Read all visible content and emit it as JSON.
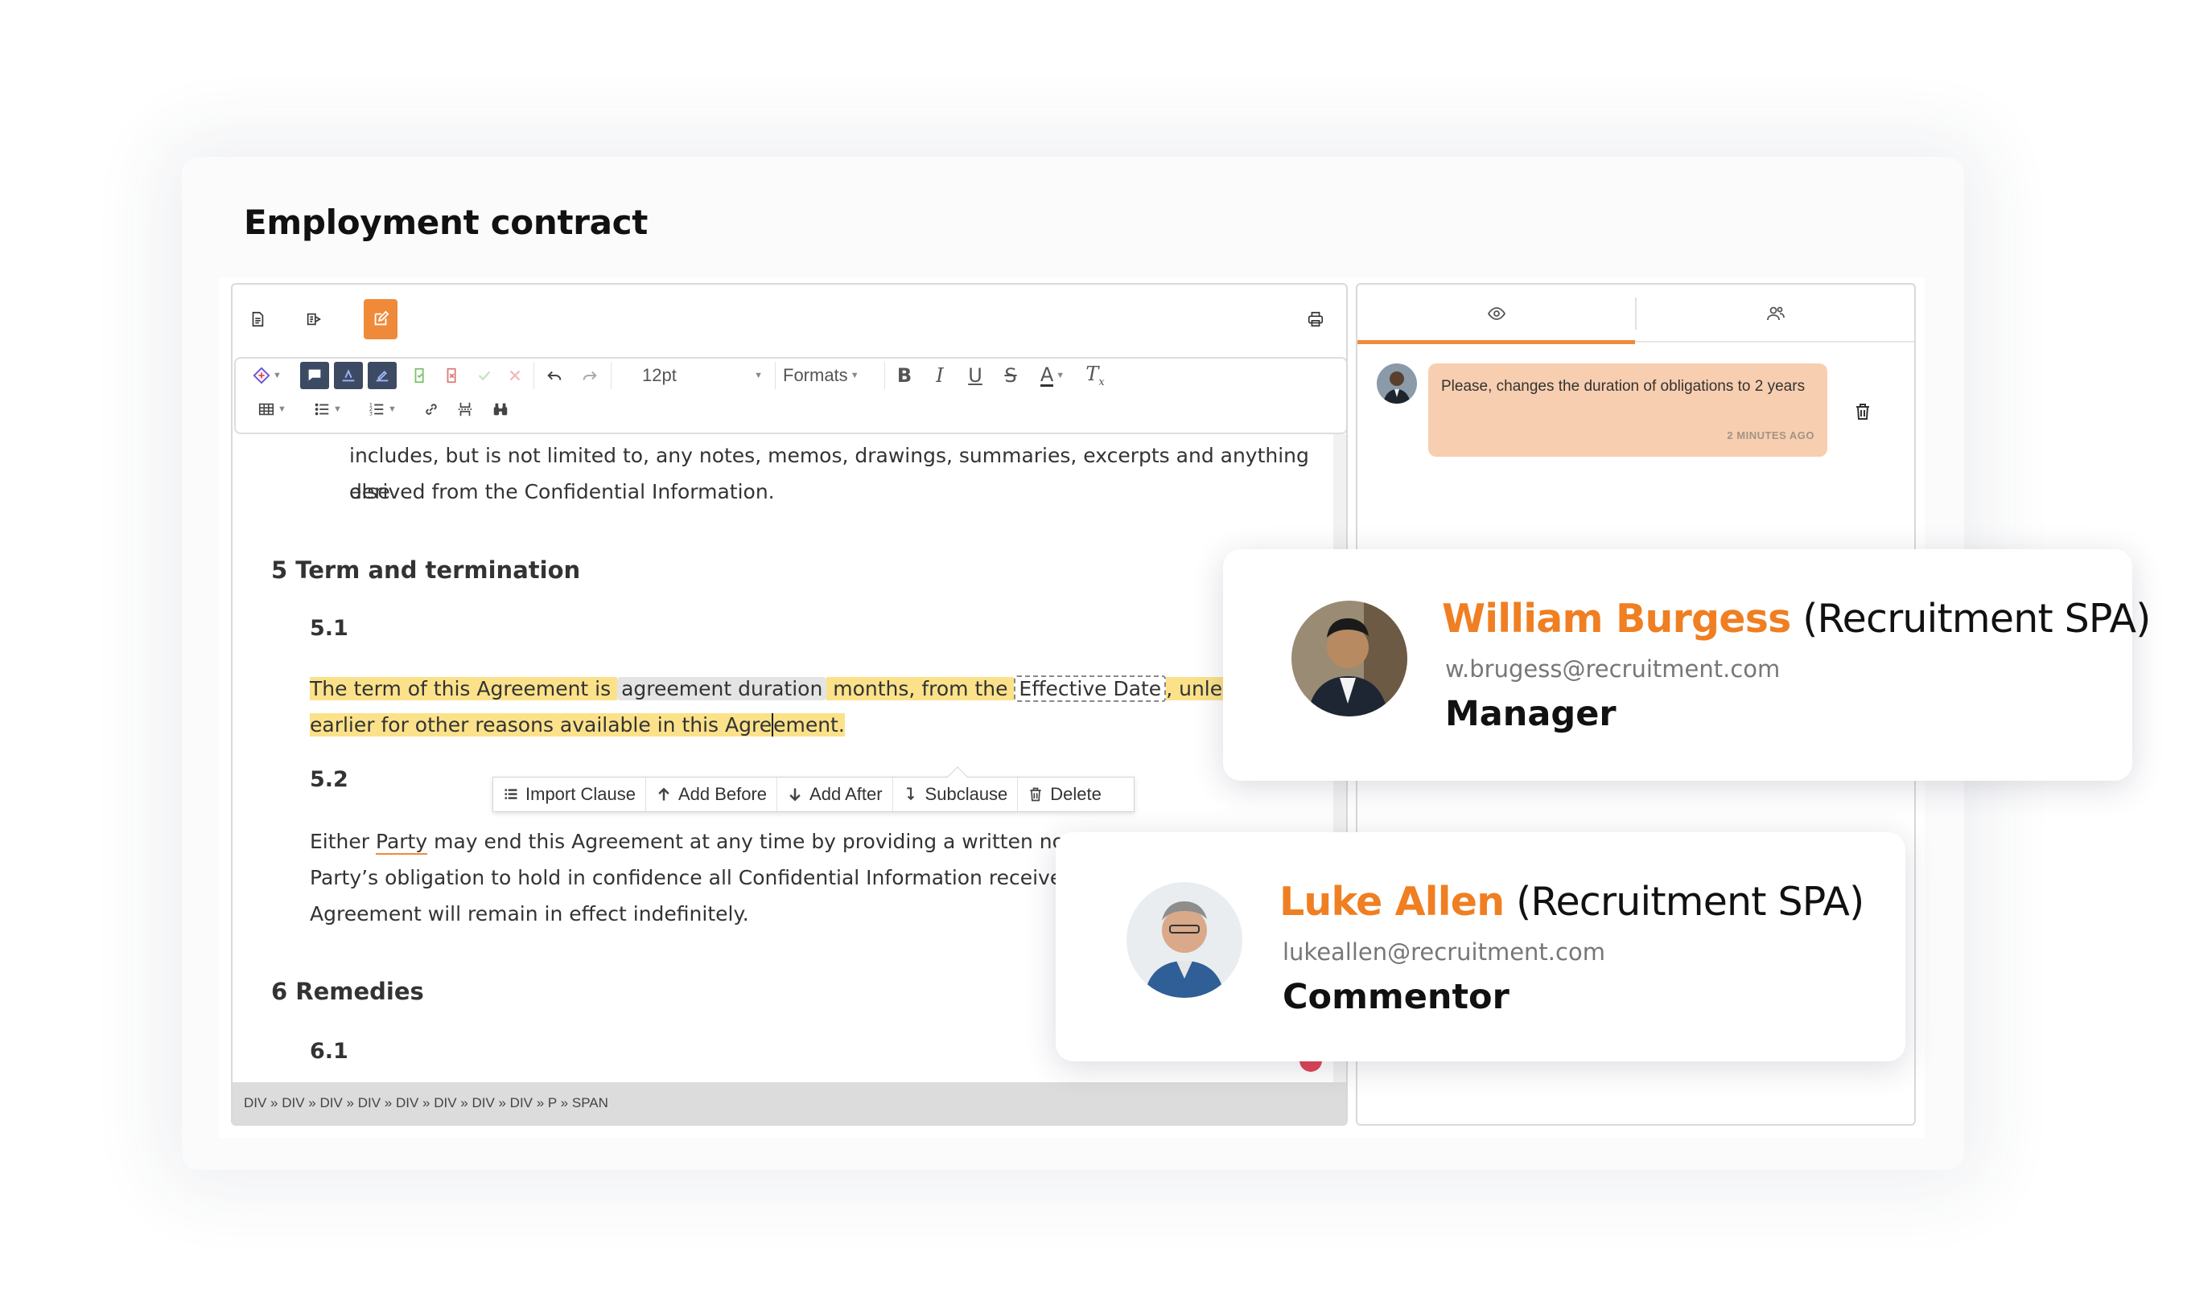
{
  "page": {
    "title": "Employment contract"
  },
  "editor": {
    "toolbar": {
      "font_size": "12pt",
      "formats_label": "Formats"
    },
    "document": {
      "intro_line1": "includes, but is not limited to, any notes, memos, drawings, summaries, excerpts and anything else",
      "intro_line2": "derived from the Confidential Information.",
      "section5_heading": "5 Term and termination",
      "s51_heading": "5.1",
      "s51_line1_part1": "The term of this Agreement is ",
      "s51_chip1": "agreement duration",
      "s51_line1_part2": " months, from the ",
      "s51_chip2": "Effective Date",
      "s51_line1_part3": ", unless ter",
      "s51_line2_part1": "earlier for other reasons available in this Agre",
      "s51_line2_part2": "ement.",
      "s52_heading": "5.2",
      "s52_line1_part1": "Either ",
      "s52_line1_party": "Party",
      "s52_line1_part2": " may end this Agreement at any time by providing a written notice t",
      "s52_line2": "Party’s obligation to hold in confidence all Confidential Information received d",
      "s52_line3": "Agreement will remain in effect indefinitely.",
      "section6_heading": "6 Remedies",
      "s61_heading": "6.1"
    },
    "clause_menu": {
      "import": "Import Clause",
      "add_before": "Add Before",
      "add_after": "Add After",
      "subclause": "Subclause",
      "delete": "Delete"
    },
    "status_path": "DIV » DIV » DIV » DIV » DIV » DIV » DIV » DIV » P » SPAN"
  },
  "comments": [
    {
      "text": "Please, changes the duration of obligations to 2 years",
      "time": "2 MINUTES AGO"
    }
  ],
  "users": [
    {
      "name": "William Burgess",
      "org": "(Recruitment SPA)",
      "email": "w.brugess@recruitment.com",
      "role": "Manager"
    },
    {
      "name": "Luke Allen",
      "org": "(Recruitment SPA)",
      "email": "lukeallen@recruitment.com",
      "role": "Commentor"
    }
  ],
  "colors": {
    "accent": "#ef8a3a",
    "highlight": "#fbe28a",
    "comment_bg": "#f7ceaf",
    "name": "#ef7f22"
  },
  "icons": [
    "document-icon",
    "document-tag-icon",
    "edit-icon",
    "print-icon",
    "clause-icon",
    "comment-icon",
    "undo-icon",
    "redo-icon",
    "bold-icon",
    "italic-icon",
    "underline-icon",
    "strikethrough-icon",
    "font-color-icon",
    "clear-format-icon",
    "table-icon",
    "bullet-list-icon",
    "numbered-list-icon",
    "link-icon",
    "page-break-icon",
    "find-icon",
    "eye-icon",
    "users-icon",
    "trash-icon"
  ]
}
